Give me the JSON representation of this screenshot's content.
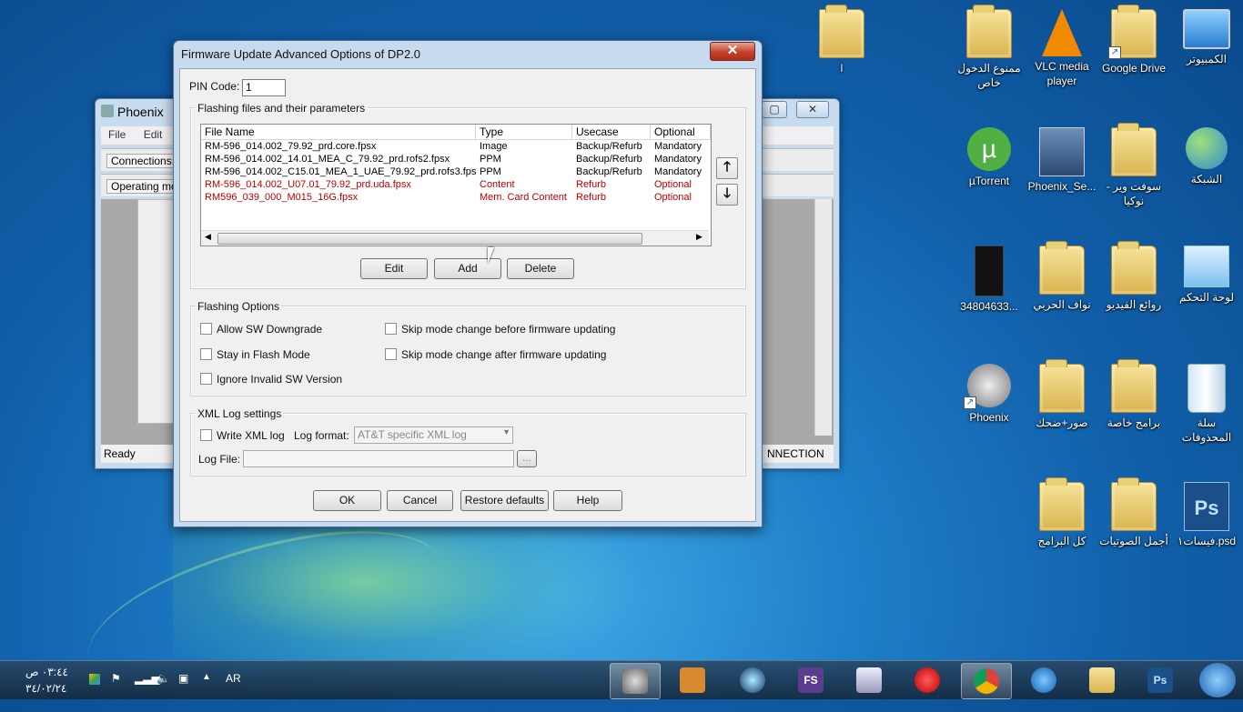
{
  "desktop": {
    "icons": [
      {
        "label": "الكمبيوتر",
        "icon": "computer-icon"
      },
      {
        "label": "Google Drive",
        "icon": "google-drive-icon"
      },
      {
        "label": "VLC media player",
        "icon": "vlc-icon"
      },
      {
        "label": "ممنوع الدخول خاص",
        "icon": "folder-icon"
      },
      {
        "label": "l",
        "icon": "folder-icon"
      },
      {
        "label": "الشبكة",
        "icon": "network-icon"
      },
      {
        "label": "سوفت وير - نوكيا",
        "icon": "folder-icon"
      },
      {
        "label": "Phoenix_Se...",
        "icon": "phoenix-service-icon"
      },
      {
        "label": "µTorrent",
        "icon": "utorrent-icon"
      },
      {
        "label": "لوحة التحكم",
        "icon": "control-panel-icon"
      },
      {
        "label": "روائع الفيديو",
        "icon": "folder-icon"
      },
      {
        "label": "نواف الحربي",
        "icon": "folder-icon"
      },
      {
        "label": "34804633...",
        "icon": "phone-image-icon"
      },
      {
        "label": "سلة المحذوفات",
        "icon": "recycle-bin-icon"
      },
      {
        "label": "برامج خاصة",
        "icon": "folder-icon"
      },
      {
        "label": "صور+ضحك",
        "icon": "folder-icon"
      },
      {
        "label": "Phoenix",
        "icon": "phoenix-icon"
      },
      {
        "label": "فيسات١.psd",
        "icon": "psd-icon"
      },
      {
        "label": "أجمل الصوتيات",
        "icon": "folder-icon"
      },
      {
        "label": "كل البرامج",
        "icon": "folder-icon"
      }
    ]
  },
  "phoenix": {
    "title": "Phoenix",
    "menu": [
      "File",
      "Edit"
    ],
    "connections_label": "Connections:",
    "operating_label": "Operating mod",
    "status_left": "Ready",
    "status_right": "NNECTION"
  },
  "dialog": {
    "title": "Firmware Update Advanced Options of DP2.0",
    "close_glyph": "✕",
    "pin_label": "PIN Code:",
    "pin_value": "1",
    "files_group": "Flashing files and their parameters",
    "columns": [
      "File Name",
      "Type",
      "Usecase",
      "Optional"
    ],
    "rows": [
      {
        "file": "RM-596_014.002_79.92_prd.core.fpsx",
        "type": "Image",
        "usecase": "Backup/Refurb",
        "optional": "Mandatory",
        "highlight": false
      },
      {
        "file": "RM-596_014.002_14.01_MEA_C_79.92_prd.rofs2.fpsx",
        "type": "PPM",
        "usecase": "Backup/Refurb",
        "optional": "Mandatory",
        "highlight": false
      },
      {
        "file": "RM-596_014.002_C15.01_MEA_1_UAE_79.92_prd.rofs3.fpsx",
        "type": "PPM",
        "usecase": "Backup/Refurb",
        "optional": "Mandatory",
        "highlight": false
      },
      {
        "file": "RM-596_014.002_U07.01_79.92_prd.uda.fpsx",
        "type": "Content",
        "usecase": "Refurb",
        "optional": "Optional",
        "highlight": true
      },
      {
        "file": "RM596_039_000_M015_16G.fpsx",
        "type": "Mem. Card Content",
        "usecase": "Refurb",
        "optional": "Optional",
        "highlight": true
      }
    ],
    "edit_label": "Edit",
    "add_label": "Add",
    "delete_label": "Delete",
    "flash_group": "Flashing Options",
    "opt_allow_downgrade": "Allow SW Downgrade",
    "opt_stay_flash": "Stay in Flash Mode",
    "opt_ignore_invalid": "Ignore Invalid SW Version",
    "opt_skip_before": "Skip mode change before firmware updating",
    "opt_skip_after": "Skip mode change after firmware updating",
    "xml_group": "XML Log settings",
    "write_xml": "Write XML log",
    "log_format_label": "Log format:",
    "log_format_value": "AT&T specific XML log",
    "log_file_label": "Log File:",
    "browse_label": "...",
    "ok_label": "OK",
    "cancel_label": "Cancel",
    "restore_label": "Restore defaults",
    "help_label": "Help"
  },
  "taskbar": {
    "lang": "AR",
    "time": "٠٣:٤٤ ص",
    "date": "٣٤/٠٢/٢٤",
    "apps": [
      "phoenix-icon",
      "nokia-tool-icon",
      "media-icon",
      "fs-icon",
      "notepad-icon",
      "opera-icon",
      "chrome-icon",
      "ie-icon",
      "explorer-icon",
      "photoshop-icon"
    ],
    "fs_text": "FS",
    "ps_text": "Ps"
  },
  "colors": {
    "highlight_row": "#c00000",
    "dialog_frame": "#c7daee"
  }
}
